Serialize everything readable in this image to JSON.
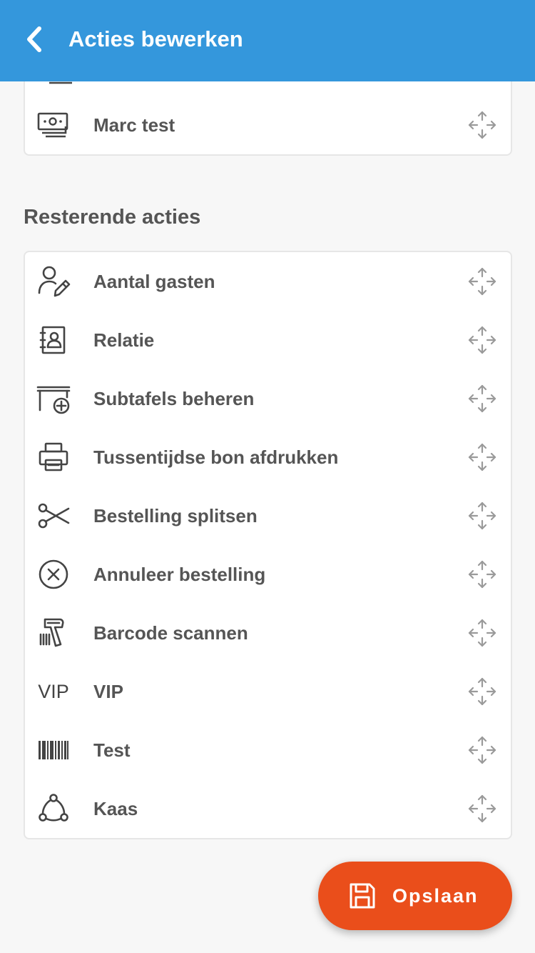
{
  "header": {
    "title": "Acties bewerken",
    "background_color": "#3497dc",
    "back_icon": "chevron-left-icon"
  },
  "active_actions": {
    "items": [
      {
        "label": "Marc test",
        "icon": "cash-icon"
      }
    ]
  },
  "remaining_actions": {
    "title": "Resterende acties",
    "items": [
      {
        "label": "Aantal gasten",
        "icon": "user-edit-icon"
      },
      {
        "label": "Relatie",
        "icon": "contact-book-icon"
      },
      {
        "label": "Subtafels beheren",
        "icon": "table-add-icon"
      },
      {
        "label": "Tussentijdse bon afdrukken",
        "icon": "printer-icon"
      },
      {
        "label": "Bestelling splitsen",
        "icon": "scissors-icon"
      },
      {
        "label": "Annuleer bestelling",
        "icon": "cancel-circle-icon"
      },
      {
        "label": "Barcode scannen",
        "icon": "barcode-scanner-icon"
      },
      {
        "label": "VIP",
        "icon": "vip-icon",
        "icon_text": "VIP"
      },
      {
        "label": "Test",
        "icon": "barcode-icon"
      },
      {
        "label": "Kaas",
        "icon": "network-icon"
      }
    ]
  },
  "save_button": {
    "label": "Opslaan",
    "icon": "floppy-disk-icon",
    "color": "#ea4e1b"
  },
  "drag_handle_icon": "move-arrows-icon"
}
